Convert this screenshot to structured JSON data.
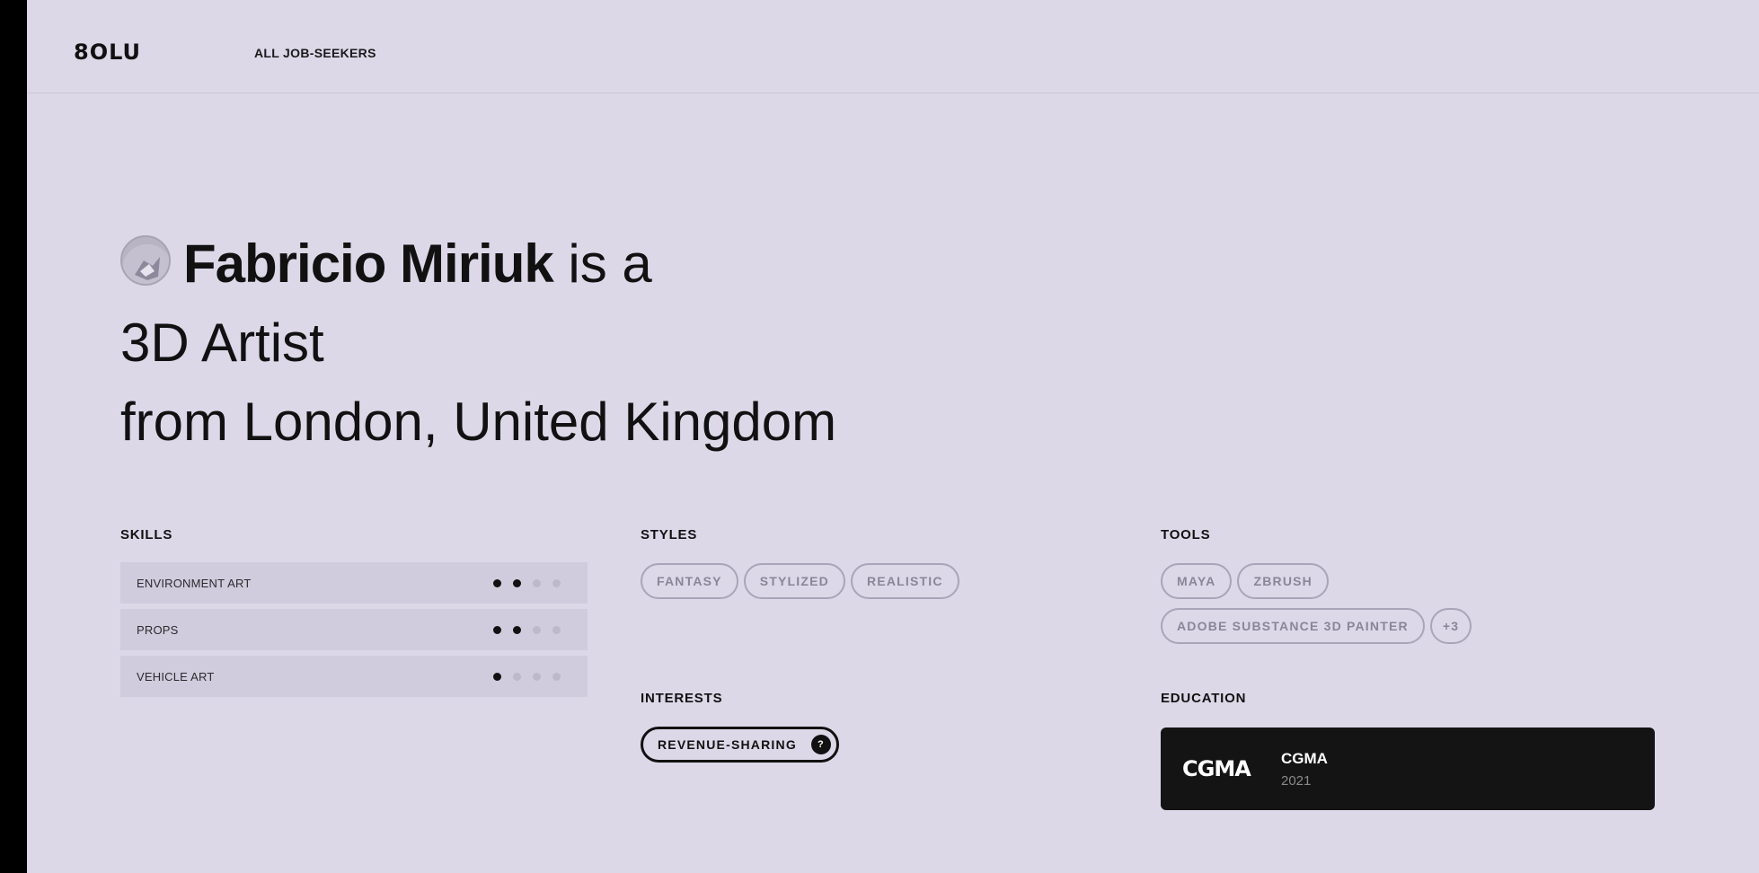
{
  "header": {
    "logo": "8OLU",
    "nav_link": "ALL JOB-SEEKERS"
  },
  "hero": {
    "name": "Fabricio Miriuk",
    "connector": " is a",
    "role": "3D Artist",
    "location": "from London, United Kingdom"
  },
  "skills": {
    "title": "SKILLS",
    "items": [
      {
        "label": "ENVIRONMENT ART",
        "level": 2,
        "max": 4
      },
      {
        "label": "PROPS",
        "level": 2,
        "max": 4
      },
      {
        "label": "VEHICLE ART",
        "level": 1,
        "max": 4
      }
    ]
  },
  "styles": {
    "title": "STYLES",
    "items": [
      "FANTASY",
      "STYLIZED",
      "REALISTIC"
    ]
  },
  "interests": {
    "title": "INTERESTS",
    "items": [
      {
        "label": "REVENUE-SHARING",
        "badge": "?"
      }
    ]
  },
  "tools": {
    "title": "TOOLS",
    "items": [
      "MAYA",
      "ZBRUSH",
      "ADOBE SUBSTANCE 3D PAINTER"
    ],
    "more": "+3"
  },
  "education": {
    "title": "EDUCATION",
    "logo_text": "CGMA",
    "name": "CGMA",
    "year": "2021"
  },
  "colors": {
    "background": "#dcd8e8",
    "text": "#111111",
    "card": "#141414"
  }
}
